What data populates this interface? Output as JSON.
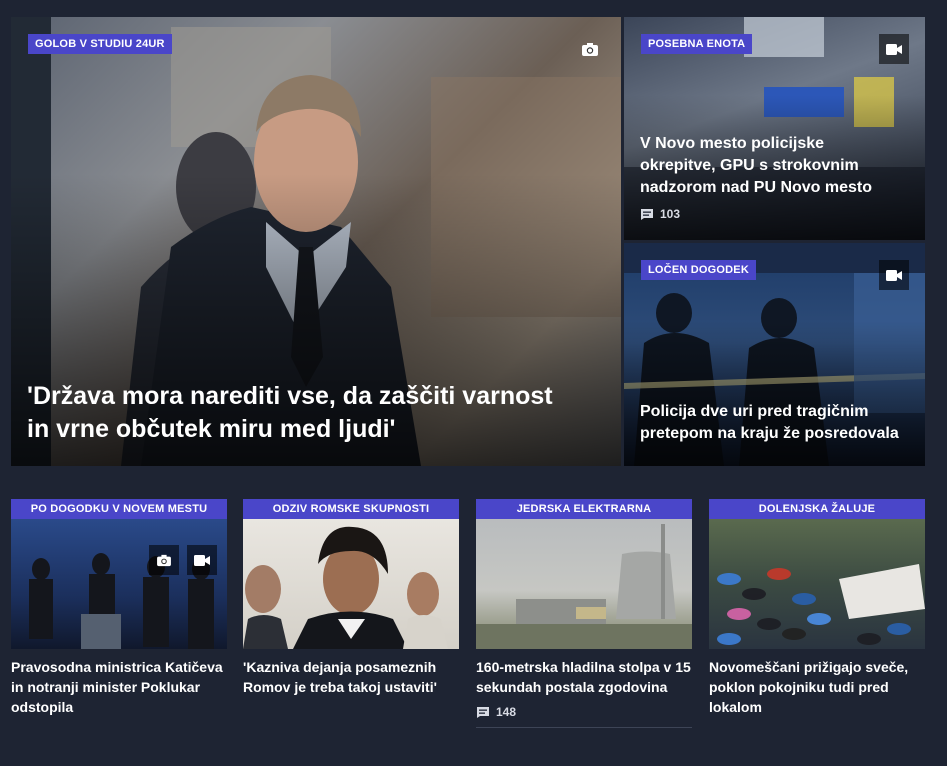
{
  "hero": {
    "badge": "GOLOB V STUDIU 24UR",
    "title": "'Država mora narediti vse, da zaščiti varnost in vrne občutek miru med ljudi'",
    "media_icon": "camera-icon"
  },
  "side_top": {
    "badge": "POSEBNA ENOTA",
    "title": "V Novo mesto policijske okrepitve, GPU s strokovnim nadzorom nad PU Novo mesto",
    "comments": "103",
    "media_icon": "video-icon"
  },
  "side_bottom": {
    "badge": "LOČEN DOGODEK",
    "title": "Policija dve uri pred tragičnim pretepom na kraju že posredovala",
    "media_icon": "video-icon"
  },
  "cards": [
    {
      "label": "PO DOGODKU V NOVEM MESTU",
      "title": "Pravosodna ministrica Katičeva in notranji minister Poklukar odstopila",
      "comments": ""
    },
    {
      "label": "ODZIV ROMSKE SKUPNOSTI",
      "title": "'Kazniva dejanja posameznih Romov je treba takoj ustaviti'",
      "comments": ""
    },
    {
      "label": "JEDRSKA ELEKTRARNA",
      "title": "160-metrska hladilna stolpa v 15 sekundah postala zgodovina",
      "comments": "148"
    },
    {
      "label": "DOLENJSKA ŽALUJE",
      "title": "Novomeščani prižigajo sveče, poklon pokojniku tudi pred lokalom",
      "comments": ""
    }
  ],
  "colors": {
    "badge": "#4a46c9",
    "background": "#1e2433"
  }
}
